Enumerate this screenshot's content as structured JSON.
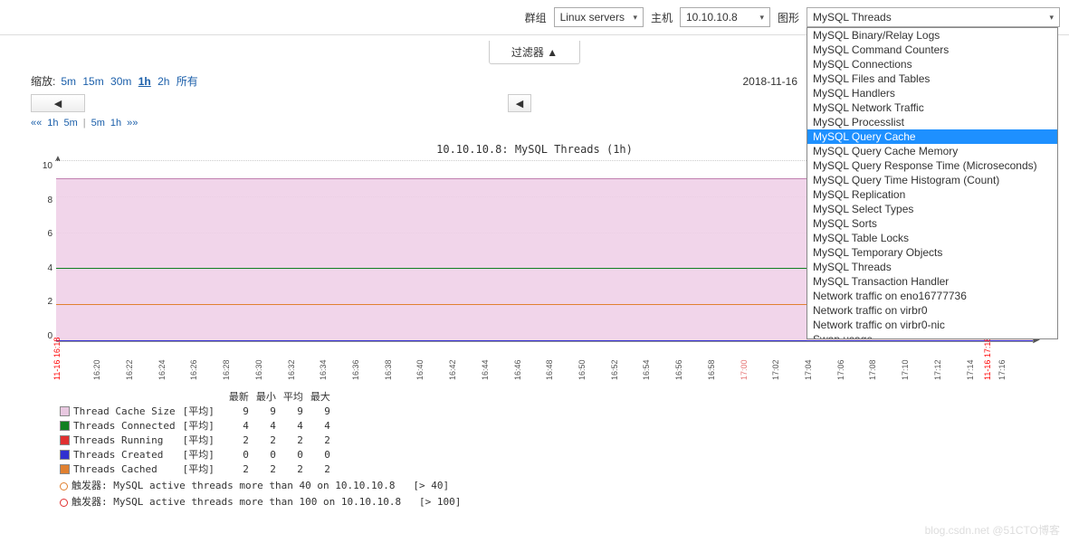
{
  "topbar": {
    "group_label": "群组",
    "group_value": "Linux servers",
    "host_label": "主机",
    "host_value": "10.10.10.8",
    "graph_label": "图形",
    "graph_value": "MySQL Threads"
  },
  "dropdown_options": [
    "MySQL Binary/Relay Logs",
    "MySQL Command Counters",
    "MySQL Connections",
    "MySQL Files and Tables",
    "MySQL Handlers",
    "MySQL Network Traffic",
    "MySQL Processlist",
    "MySQL Query Cache",
    "MySQL Query Cache Memory",
    "MySQL Query Response Time (Microseconds)",
    "MySQL Query Time Histogram (Count)",
    "MySQL Replication",
    "MySQL Select Types",
    "MySQL Sorts",
    "MySQL Table Locks",
    "MySQL Temporary Objects",
    "MySQL Threads",
    "MySQL Transaction Handler",
    "Network traffic on eno16777736",
    "Network traffic on virbr0",
    "Network traffic on virbr0-nic",
    "Swap usage"
  ],
  "dropdown_highlight_index": 7,
  "filter_label": "过滤器 ▲",
  "zoom": {
    "label": "缩放:",
    "opts": [
      "5m",
      "15m",
      "30m",
      "1h",
      "2h",
      "所有"
    ],
    "active": "1h",
    "date": "2018-11-16"
  },
  "nav_left": "◀",
  "nav_right": "◀",
  "pager": {
    "prefix": "«« ",
    "items": [
      "1h",
      "5m",
      "|",
      "5m",
      "1h"
    ],
    "suffix": " »»"
  },
  "chart_data": {
    "type": "line",
    "title": "10.10.10.8: MySQL Threads (1h)",
    "ylim": [
      0,
      10
    ],
    "yticks": [
      0,
      2,
      4,
      6,
      8,
      10
    ],
    "x_start_label": "11-16 16:18",
    "x_end_label": "11-16 17:18",
    "xticks": [
      "16:20",
      "16:22",
      "16:24",
      "16:26",
      "16:28",
      "16:30",
      "16:32",
      "16:34",
      "16:36",
      "16:38",
      "16:40",
      "16:42",
      "16:44",
      "16:46",
      "16:48",
      "16:50",
      "16:52",
      "16:54",
      "16:56",
      "16:58",
      "17:00",
      "17:02",
      "17:04",
      "17:06",
      "17:08",
      "17:10",
      "17:12",
      "17:14",
      "17:16"
    ],
    "xtick_red_index": 20,
    "series": [
      {
        "name": "Thread Cache Size",
        "color": "#E8C8E0",
        "value": 9,
        "agg": "[平均]",
        "last": 9,
        "min": 9,
        "avg": 9,
        "max": 9
      },
      {
        "name": "Threads Connected",
        "color": "#108020",
        "value": 4,
        "agg": "[平均]",
        "last": 4,
        "min": 4,
        "avg": 4,
        "max": 4
      },
      {
        "name": "Threads Running",
        "color": "#E03030",
        "value": 2,
        "agg": "[平均]",
        "last": 2,
        "min": 2,
        "avg": 2,
        "max": 2
      },
      {
        "name": "Threads Created",
        "color": "#3030D0",
        "value": 0,
        "agg": "[平均]",
        "last": 0,
        "min": 0,
        "avg": 0,
        "max": 0
      },
      {
        "name": "Threads Cached",
        "color": "#E08030",
        "value": 2,
        "agg": "[平均]",
        "last": 2,
        "min": 2,
        "avg": 2,
        "max": 2
      }
    ],
    "legend_headers": [
      "",
      "",
      "",
      "最新",
      "最小",
      "平均",
      "最大"
    ]
  },
  "triggers": [
    {
      "color": "#E08030",
      "text": "触发器: MySQL active threads more than 40 on 10.10.10.8",
      "th": "[> 40]"
    },
    {
      "color": "#E03030",
      "text": "触发器: MySQL active threads more than 100 on 10.10.10.8",
      "th": "[> 100]"
    }
  ],
  "watermark": "blog.csdn.net @51CTO博客"
}
